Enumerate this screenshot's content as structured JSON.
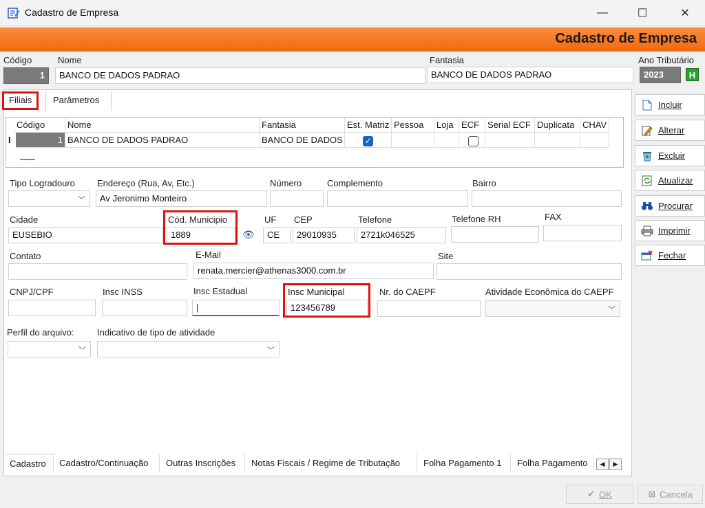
{
  "window": {
    "title": "Cadastro de Empresa",
    "minimize": "—",
    "maximize": "☐",
    "close": "✕"
  },
  "header": {
    "title": "Cadastro de Empresa"
  },
  "top_fields": {
    "codigo_label": "Código",
    "codigo_value": "1",
    "nome_label": "Nome",
    "nome_value": "BANCO DE DADOS PADRAO",
    "fantasia_label": "Fantasia",
    "fantasia_value": "BANCO DE DADOS PADRAO",
    "ano_label": "Ano Tributário",
    "ano_value": "2023",
    "ano_badge": "H"
  },
  "top_tabs": [
    "Filiais",
    "Parâmetros"
  ],
  "grid": {
    "columns": [
      "Código",
      "Nome",
      "Fantasia",
      "Est. Matriz",
      "Pessoa",
      "Loja",
      "ECF",
      "Serial ECF",
      "Duplicata",
      "CHAV"
    ],
    "row": {
      "marker": "I",
      "codigo": "1",
      "nome": "BANCO DE DADOS PADRAO",
      "fantasia": "BANCO DE DADOS PADRAO",
      "est_matriz": true,
      "ecf": false
    }
  },
  "form": {
    "tipo_logradouro_label": "Tipo Logradouro",
    "tipo_logradouro_value": "",
    "endereco_label": "Endereço (Rua, Av,  Etc.)",
    "endereco_value": "Av Jeronimo Monteiro",
    "numero_label": "Número",
    "numero_value": "",
    "complemento_label": "Complemento",
    "complemento_value": "",
    "bairro_label": "Bairro",
    "bairro_value": "",
    "cidade_label": "Cidade",
    "cidade_value": "EUSEBIO",
    "cod_municipio_label": "Cód. Municipio",
    "cod_municipio_value": "1889",
    "uf_label": "UF",
    "uf_value": "CE",
    "cep_label": "CEP",
    "cep_value": "29010935",
    "telefone_label": "Telefone",
    "telefone_value": "2721k046525",
    "telefone_rh_label": "Telefone RH",
    "telefone_rh_value": "",
    "fax_label": "FAX",
    "fax_value": "",
    "contato_label": "Contato",
    "contato_value": "",
    "email_label": "E-Mail",
    "email_value": "renata.mercier@athenas3000.com.br",
    "site_label": "Site",
    "site_value": "",
    "cnpj_label": "CNPJ/CPF",
    "cnpj_value": "",
    "inss_label": "Insc INSS",
    "inss_value": "",
    "estadual_label": "Insc Estadual",
    "estadual_value": "|",
    "municipal_label": "Insc Municipal",
    "municipal_value": "123456789",
    "caepf_label": "Nr. do CAEPF",
    "caepf_value": "",
    "atividade_label": "Atividade Econômica do CAEPF",
    "atividade_value": "",
    "perfil_label": "Perfil do arquivo:",
    "perfil_value": "",
    "indicativo_label": "Indicativo de tipo de atividade",
    "indicativo_value": ""
  },
  "bottom_tabs": [
    "Cadastro",
    "Cadastro/Continuação",
    "Outras Inscrições",
    "Notas Fiscais / Regime de Tributação",
    "Folha Pagamento 1",
    "Folha Pagamento"
  ],
  "side_buttons": [
    {
      "label": "Incluir",
      "icon": "new-document-icon"
    },
    {
      "label": "Alterar",
      "icon": "edit-icon"
    },
    {
      "label": "Excluir",
      "icon": "recycle-bin-icon"
    },
    {
      "label": "Atualizar",
      "icon": "refresh-icon"
    },
    {
      "label": "Procurar",
      "icon": "binoculars-icon"
    },
    {
      "label": "Imprimir",
      "icon": "printer-icon"
    },
    {
      "label": "Fechar",
      "icon": "close-window-icon"
    }
  ],
  "footer": {
    "ok_label": "OK",
    "cancel_label": "Cancela"
  },
  "colors": {
    "accent_orange": "#f47b20",
    "highlight_red": "#e01010",
    "check_blue": "#1565c0",
    "ano_badge_green": "#2e9e2e"
  }
}
